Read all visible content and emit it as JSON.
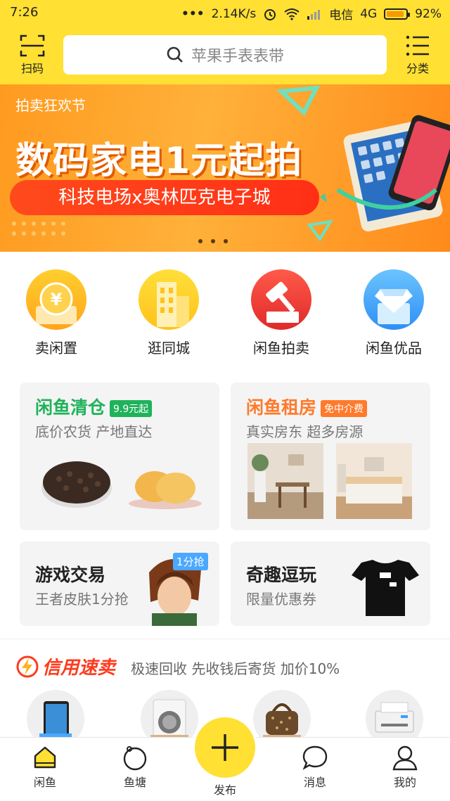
{
  "status_bar": {
    "time": "7:26",
    "dots": "•••",
    "speed": "2.14K/s",
    "carrier": "电信",
    "network": "4G",
    "battery": "92%",
    "battery_fraction": 0.92
  },
  "header": {
    "scan_label": "扫码",
    "search_placeholder": "苹果手表表带",
    "category_label": "分类"
  },
  "banner": {
    "small": "拍卖狂欢节",
    "big": "数码家电1元起拍",
    "pill": "科技电场x奥林匹克电子城",
    "slides": 3,
    "active_slide": 1
  },
  "quick": [
    {
      "label": "卖闲置",
      "icon": "yen-icon"
    },
    {
      "label": "逛同城",
      "icon": "building-icon"
    },
    {
      "label": "闲鱼拍卖",
      "icon": "gavel-icon"
    },
    {
      "label": "闲鱼优品",
      "icon": "diamond-icon"
    }
  ],
  "cards": {
    "clearance": {
      "title": "闲鱼清仓",
      "badge": "9.9元起",
      "sub": "底价农货 产地直达"
    },
    "rental": {
      "title": "闲鱼租房",
      "badge": "免中介费",
      "sub": "真实房东 超多房源"
    },
    "games": {
      "title": "游戏交易",
      "badge": "1分抢",
      "sub": "王者皮肤1分抢"
    },
    "fun": {
      "title": "奇趣逗玩",
      "sub": "限量优惠券"
    }
  },
  "credit": {
    "logo": "信用速卖",
    "text": "极速回收 先收钱后寄货 加价10%"
  },
  "tabs": {
    "home": "闲鱼",
    "pond": "鱼塘",
    "publish": "发布",
    "messages": "消息",
    "mine": "我的"
  },
  "colors": {
    "brand_yellow": "#ffe033",
    "green": "#1fb25a",
    "orange": "#ff7a2b",
    "blue": "#3aa0ff",
    "red": "#ff3b1f"
  }
}
